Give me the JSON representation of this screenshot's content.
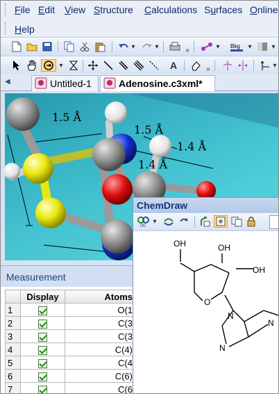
{
  "menu": {
    "items": [
      "File",
      "Edit",
      "View",
      "Structure",
      "Calculations",
      "Surfaces",
      "Online"
    ],
    "underline": [
      "F",
      "E",
      "V",
      "S",
      "C",
      "u",
      "O"
    ],
    "help": "Help",
    "help_underline": "H"
  },
  "toolbar1": {
    "icons": [
      "new-document-icon",
      "open-folder-icon",
      "save-icon",
      "copy-icon",
      "cut-icon",
      "paste-icon",
      "undo-icon",
      "redo-icon",
      "print-icon",
      "model-display-icon",
      "background-color-icon"
    ],
    "bkg_label": "Bkg"
  },
  "toolbar2": {
    "icons": [
      "select-arrow-icon",
      "hand-trackball-icon",
      "rotate-icon",
      "zoom-icon",
      "translate-icon",
      "single-bond-icon",
      "double-bond-icon",
      "triple-bond-icon",
      "dummy-bond-icon",
      "text-tool-icon",
      "eraser-icon",
      "spin-icon",
      "flip-icon"
    ],
    "text_tool_label": "A"
  },
  "tabs": [
    {
      "label": "Untitled-1",
      "active": false
    },
    {
      "label": "Adenosine.c3xml*",
      "active": true
    }
  ],
  "viewport": {
    "distance_labels": [
      "1.5 Å",
      "1.5 Å",
      "1.4 Å",
      "1.4 Å"
    ]
  },
  "measurement": {
    "title": "Measurement",
    "columns": [
      "",
      "Display",
      "Atoms"
    ],
    "rows": [
      {
        "index": "1",
        "display": true,
        "atoms": "O(1"
      },
      {
        "index": "2",
        "display": true,
        "atoms": "C(3"
      },
      {
        "index": "3",
        "display": true,
        "atoms": "C(3"
      },
      {
        "index": "4",
        "display": true,
        "atoms": "C(4)"
      },
      {
        "index": "5",
        "display": true,
        "atoms": "C(4"
      },
      {
        "index": "6",
        "display": true,
        "atoms": "C(6)"
      },
      {
        "index": "7",
        "display": true,
        "atoms": "C(6"
      }
    ]
  },
  "chemdraw": {
    "title": "ChemDraw",
    "atom_labels": [
      "OH",
      "OH",
      "OH",
      "O",
      "N",
      "N",
      "N"
    ]
  },
  "colors": {
    "carbon": "#8c8c8c",
    "oxygen": "#e01010",
    "nitrogen": "#1030d0",
    "sulfur": "#e8e810",
    "hydrogen": "#f2f2f2",
    "accent": "#1f3f7a"
  }
}
